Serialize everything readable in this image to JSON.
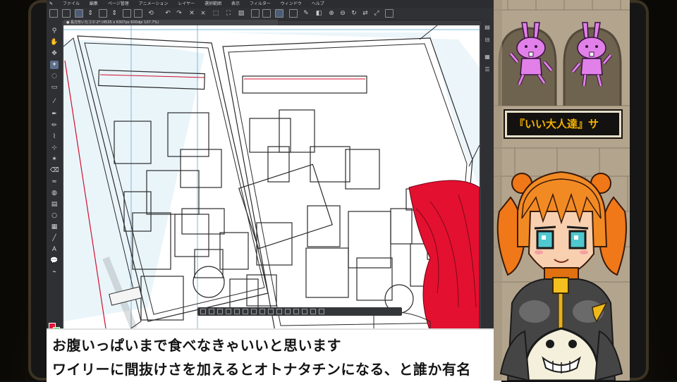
{
  "menu": {
    "items": [
      "ファイル",
      "編集",
      "ページ管理",
      "アニメーション",
      "レイヤー",
      "選択範囲",
      "表示",
      "フィルター",
      "ウィンドウ",
      "ヘルプ"
    ]
  },
  "document_tab": {
    "label": "● 長方形いちコマ-2* (4535 x 6307px 600dpi 107.7%)"
  },
  "overlay": {
    "name_box": "『いい大人達』サ"
  },
  "subtitle": {
    "line1": "お腹いっぱいまで食べなきゃいいと思います",
    "line2": "ワイリーに間抜けさを加えるとオトナタチンになる、と誰か有名"
  },
  "colors": {
    "accent_red": "#e0183c",
    "accent_green": "#2cd038",
    "name_text": "#f4b200",
    "bunny_pink": "#e080e8"
  }
}
